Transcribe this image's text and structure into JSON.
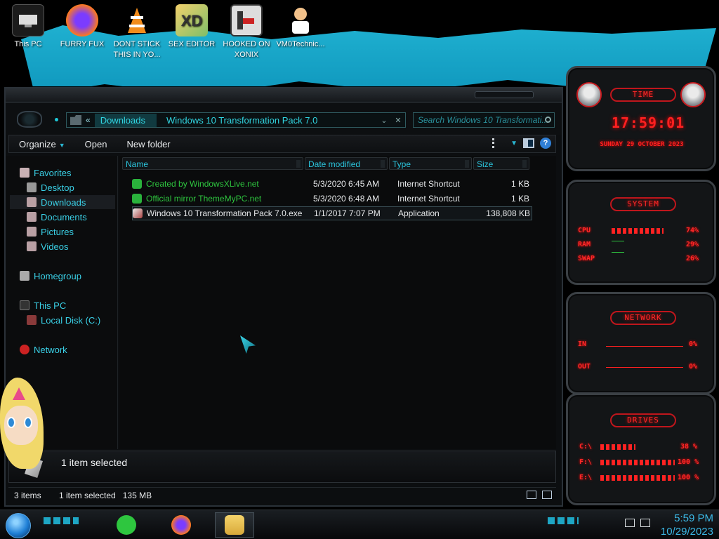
{
  "desktop": {
    "icons": [
      {
        "label": "This PC",
        "icon": "this-pc-icon"
      },
      {
        "label": "FURRY FUX",
        "icon": "firefox-icon"
      },
      {
        "label": "DONT STICK THIS IN YO...",
        "icon": "vlc-icon"
      },
      {
        "label": "SEX EDITOR",
        "icon": "hxd-icon"
      },
      {
        "label": "HOOKED ON XONIX",
        "icon": "game-icon"
      },
      {
        "label": "VM0Technic...",
        "icon": "doctor-icon"
      }
    ]
  },
  "explorer": {
    "address": {
      "crumb1": "Downloads",
      "crumb2": "Windows 10 Transformation Pack 7.0"
    },
    "search_placeholder": "Search Windows 10 Transformati...",
    "toolbar": {
      "organize": "Organize",
      "open": "Open",
      "new_folder": "New folder"
    },
    "nav": {
      "favorites": "Favorites",
      "desktop": "Desktop",
      "downloads": "Downloads",
      "documents": "Documents",
      "pictures": "Pictures",
      "videos": "Videos",
      "homegroup": "Homegroup",
      "this_pc": "This PC",
      "local_disk": "Local Disk (C:)",
      "network": "Network"
    },
    "columns": {
      "name": "Name",
      "date": "Date modified",
      "type": "Type",
      "size": "Size"
    },
    "files": [
      {
        "name": "Created by WindowsXLive.net",
        "date": "5/3/2020 6:45 AM",
        "type": "Internet Shortcut",
        "size": "1 KB"
      },
      {
        "name": "Official mirror ThemeMyPC.net",
        "date": "5/3/2020 6:48 AM",
        "type": "Internet Shortcut",
        "size": "1 KB"
      },
      {
        "name": "Windows 10 Transformation Pack 7.0.exe",
        "date": "1/1/2017 7:07 PM",
        "type": "Application",
        "size": "138,808 KB"
      }
    ],
    "details_text": "1 item selected",
    "status": {
      "items": "3 items",
      "selected": "1 item selected",
      "size": "135 MB"
    }
  },
  "gadgets": {
    "time": {
      "header": "TIME",
      "clock": "17:59:01",
      "date": "SUNDAY 29 OCTOBER 2023"
    },
    "system": {
      "header": "SYSTEM",
      "cpu_label": "CPU",
      "cpu_value": "74%",
      "cpu_level": 0.74,
      "ram_label": "RAM",
      "ram_value": "29%",
      "swap_label": "SWAP",
      "swap_value": "26%"
    },
    "network": {
      "header": "NETWORK",
      "in_label": "IN",
      "in_value": "0%",
      "out_label": "OUT",
      "out_value": "0%"
    },
    "drives": {
      "header": "DRIVES",
      "d1_label": "C:\\",
      "d1_value": "38 %",
      "d2_label": "F:\\",
      "d2_value": "100 %",
      "d3_label": "E:\\",
      "d3_value": "100 %"
    }
  },
  "taskbar": {
    "time": "5:59 PM",
    "date": "10/29/2023"
  },
  "colors": {
    "accent": "#2bc4dc",
    "alert": "#ff2020",
    "link": "#2ec63f"
  }
}
